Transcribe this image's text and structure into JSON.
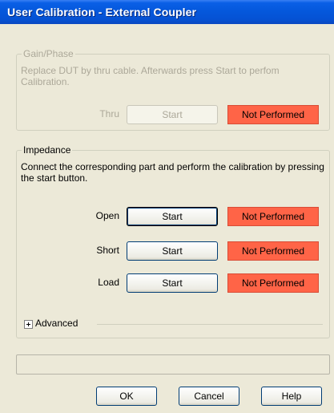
{
  "window": {
    "title": "User Calibration - External Coupler"
  },
  "gain_phase": {
    "legend": "Gain/Phase",
    "description": "Replace DUT by thru cable. Afterwards press Start to perfom Calibration.",
    "rows": [
      {
        "label": "Thru",
        "button": "Start",
        "status": "Not Performed"
      }
    ]
  },
  "impedance": {
    "legend": "Impedance",
    "description": "Connect the corresponding part and perform the calibration by pressing the start button.",
    "rows": [
      {
        "label": "Open",
        "button": "Start",
        "status": "Not Performed"
      },
      {
        "label": "Short",
        "button": "Start",
        "status": "Not Performed"
      },
      {
        "label": "Load",
        "button": "Start",
        "status": "Not Performed"
      }
    ]
  },
  "advanced": {
    "label": "Advanced",
    "icon": "plus-expander-icon"
  },
  "status_bar": {
    "text": ""
  },
  "footer": {
    "ok": "OK",
    "cancel": "Cancel",
    "help": "Help"
  },
  "colors": {
    "titlebar": "#0558dc",
    "window_bg": "#ece9d8",
    "status_not_performed": "#ff6447",
    "disabled_text": "#aca899"
  }
}
